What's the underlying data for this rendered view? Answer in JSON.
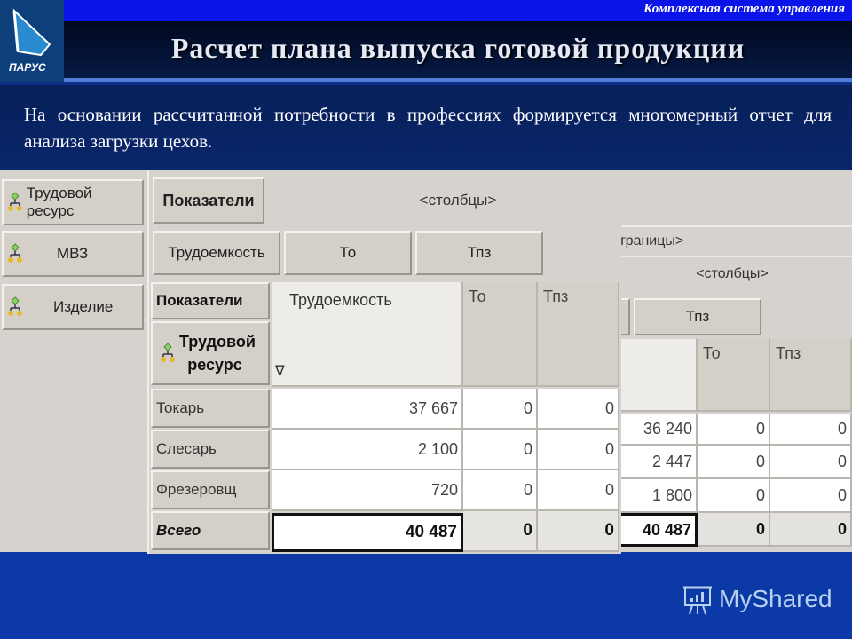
{
  "header": {
    "tagline": "Комплексная система управления",
    "title": "Расчет плана выпуска готовой продукции",
    "logo_icon": "parus-sail-logo",
    "logo_text": "ПАРУС"
  },
  "description": "На основании рассчитанной потребности в профессиях формируется многомерный отчет для анализа загрузки цехов.",
  "dimension_panel": {
    "items": [
      {
        "label": "Трудовой ресурс",
        "icon": "hierarchy-icon"
      },
      {
        "label": "МВЗ",
        "icon": "hierarchy-icon"
      },
      {
        "label": "Изделие",
        "icon": "hierarchy-icon"
      }
    ]
  },
  "front_report": {
    "filter_button": "Показатели",
    "columns_area_label": "<столбцы>",
    "column_buttons": [
      "Трудоемкость",
      "То",
      "Тпз"
    ],
    "corner_label": "Показатели",
    "row_dimension": "Трудовой ресурс",
    "column_headers": [
      "Трудоемкость",
      "То",
      "Тпз"
    ],
    "filter_marker": "∇",
    "rows": [
      {
        "label": "Токарь",
        "values": [
          "37 667",
          "0",
          "0"
        ]
      },
      {
        "label": "Слесарь",
        "values": [
          "2 100",
          "0",
          "0"
        ]
      },
      {
        "label": "Фрезеровщ",
        "values": [
          "720",
          "0",
          "0"
        ]
      }
    ],
    "total": {
      "label": "Всего",
      "values": [
        "40 487",
        "0",
        "0"
      ]
    }
  },
  "back_report": {
    "pages_area_label": "<страницы>",
    "columns_area_label": "<столбцы>",
    "column_buttons": [
      "Тпз"
    ],
    "column_headers": [
      "То",
      "Тпз"
    ],
    "left_partial_values": [
      "0",
      "0",
      "0",
      "0"
    ],
    "rows": [
      {
        "values": [
          "36 240",
          "0",
          "0"
        ]
      },
      {
        "values": [
          "2 447",
          "0",
          "0"
        ]
      },
      {
        "values": [
          "1 800",
          "0",
          "0"
        ]
      }
    ],
    "total": {
      "values": [
        "40 487",
        "0",
        "0"
      ]
    }
  },
  "watermark": {
    "text": "MyShared",
    "icon": "presentation-board-icon"
  }
}
